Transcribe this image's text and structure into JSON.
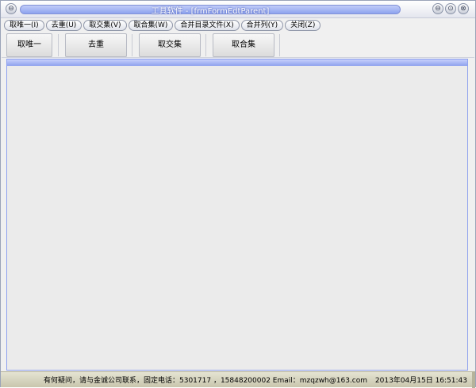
{
  "window": {
    "title": "工具软件 - [frmFormEdtParent]",
    "controls": {
      "system": "⊖",
      "minimize": "⊖",
      "maximize": "⊙",
      "close": "⊗"
    }
  },
  "menu": {
    "items": [
      {
        "label": "取唯一(I)"
      },
      {
        "label": "去重(U)"
      },
      {
        "label": "取交集(V)"
      },
      {
        "label": "取合集(W)"
      },
      {
        "label": "合并目录文件(X)"
      },
      {
        "label": "合并列(Y)"
      },
      {
        "label": "关闭(Z)"
      }
    ]
  },
  "toolbar": {
    "buttons": [
      {
        "label": "取唯一"
      },
      {
        "label": "去重"
      },
      {
        "label": "取交集"
      },
      {
        "label": "取合集"
      }
    ]
  },
  "status": {
    "info": "有何疑问，请与金诚公司联系，固定电话：5301717 ，15848200002 Email：mzqzwh@163.com",
    "datetime": "2013年04月15日  16:51:43"
  },
  "colors": {
    "title_accent": "#8da3ef",
    "content_border": "#8ea1ee",
    "status_bg": "#d6d4be"
  }
}
